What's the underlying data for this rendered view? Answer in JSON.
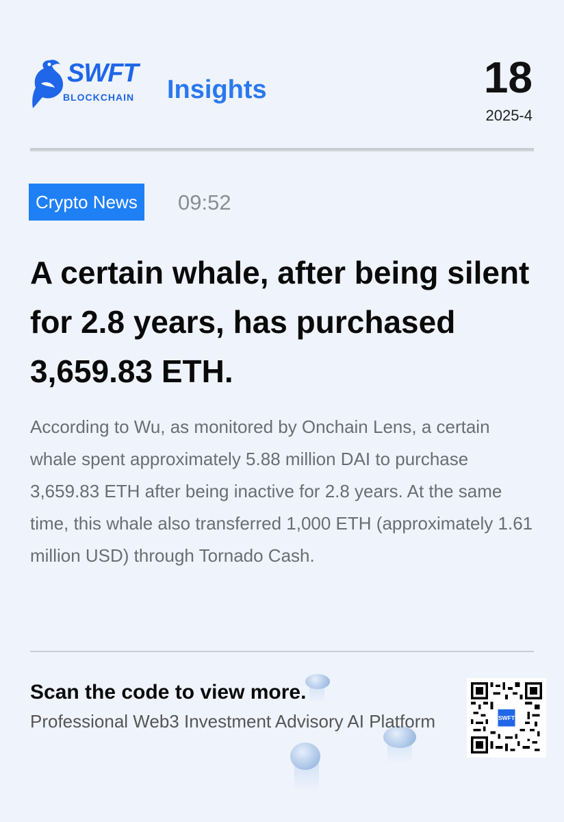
{
  "header": {
    "logo_word": "SWFT",
    "logo_sub": "BLOCKCHAIN",
    "section": "Insights",
    "day": "18",
    "year_month": "2025-4"
  },
  "article": {
    "tag": "Crypto News",
    "time": "09:52",
    "headline": "A certain whale, after being silent for 2.8 years, has purchased 3,659.83 ETH.",
    "body": "According to Wu, as monitored by Onchain Lens, a certain whale spent approximately 5.88 million DAI to purchase 3,659.83 ETH after being inactive for 2.8 years. At the same time, this whale also transferred 1,000 ETH (approximately 1.61 million USD) through Tornado Cash."
  },
  "footer": {
    "scan_title": "Scan the code to view more.",
    "subtitle": "Professional Web3 Investment Advisory AI Platform"
  },
  "colors": {
    "background": "#eff3fb",
    "brand_blue": "#1f66e8",
    "tag_blue": "#1f80f6",
    "muted_text": "#6a6d73"
  },
  "icons": [
    "swft-bird-logo-icon",
    "coin-icon",
    "qr-code"
  ]
}
